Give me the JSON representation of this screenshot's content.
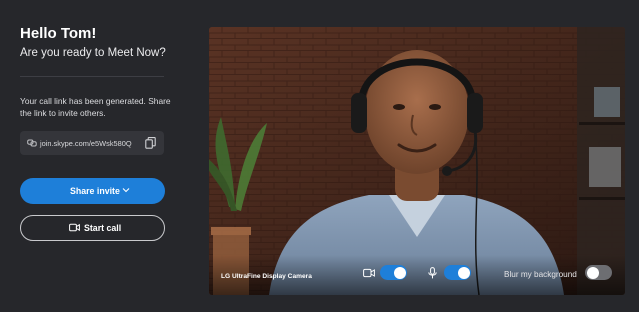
{
  "greeting": "Hello Tom!",
  "subtitle": "Are you ready to Meet Now?",
  "call_link": {
    "info": "Your call link has been generated. Share the link to invite others.",
    "url": "join.skype.com/e5Wsk580Q"
  },
  "buttons": {
    "share_label": "Share invite",
    "start_label": "Start call"
  },
  "preview": {
    "camera_name": "LG UltraFine Display Camera",
    "video_on": true,
    "mic_on": true,
    "blur_label": "Blur my background",
    "blur_on": false
  },
  "colors": {
    "background": "#26272b",
    "accent": "#1e7fd9"
  },
  "icons": [
    "link-icon",
    "copy-icon",
    "chevron-down-icon",
    "video-camera-icon",
    "microphone-icon"
  ]
}
